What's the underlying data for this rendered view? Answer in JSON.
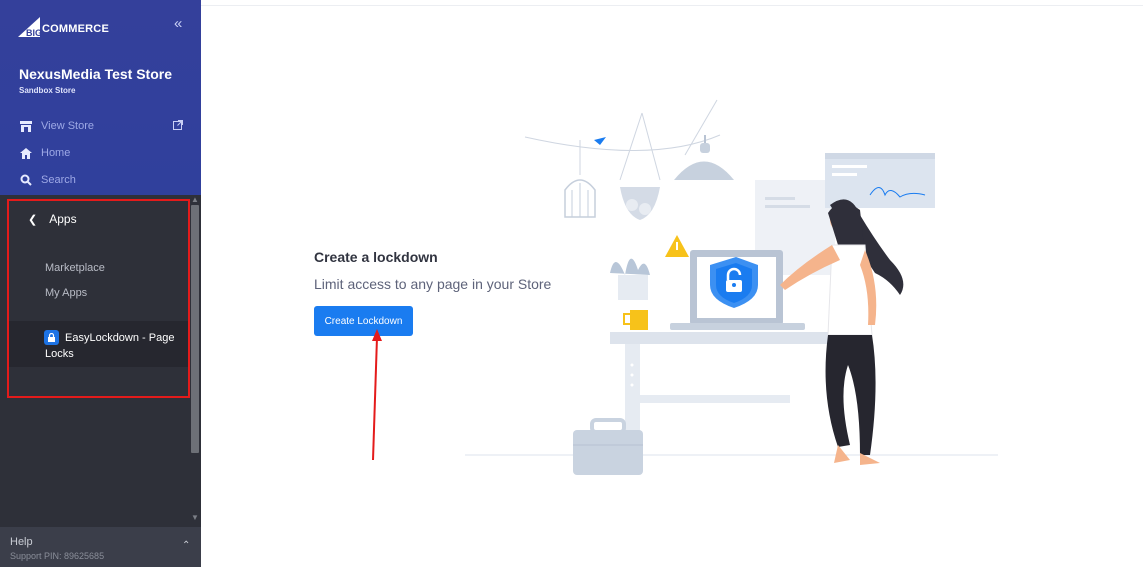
{
  "sidebar": {
    "logo_text": "COMMERCE",
    "logo_big": "BIG",
    "collapse_glyph": "«",
    "store_name": "NexusMedia Test Store",
    "store_sub": "Sandbox Store",
    "nav": [
      {
        "label": "View Store",
        "icon": "storefront-icon"
      },
      {
        "label": "Home",
        "icon": "home-icon"
      },
      {
        "label": "Search",
        "icon": "search-icon"
      }
    ],
    "apps_header": "Apps",
    "sub_items": [
      "Marketplace",
      "My Apps"
    ],
    "active_app": "EasyLockdown - Page Locks"
  },
  "help": {
    "title": "Help",
    "support": "Support PIN: 89625685"
  },
  "main": {
    "heading": "Create a lockdown",
    "subheading": "Limit access to any page in your Store",
    "button_label": "Create Lockdown"
  },
  "colors": {
    "sidebar_top": "#34409b",
    "sidebar_dark": "#2e3039",
    "button": "#1a7cf0",
    "annotation": "#e41b1b"
  }
}
